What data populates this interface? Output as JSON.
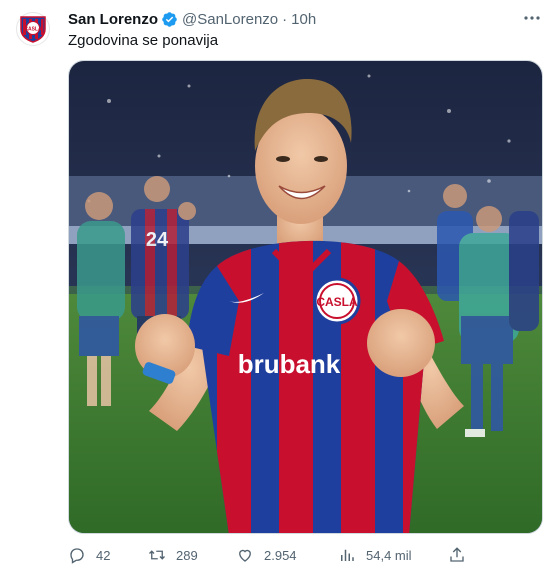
{
  "tweet": {
    "author": {
      "display_name": "San Lorenzo",
      "verified": true,
      "handle": "@SanLorenzo",
      "separator": "·",
      "timestamp": "10h",
      "avatar_icon": "san-lorenzo-crest-icon"
    },
    "text": "Zgodovina se ponavija",
    "media": {
      "shirt_sponsor": "brubank",
      "shirt_crest": "CASLA",
      "shirt_number": "24"
    },
    "actions": {
      "replies": "42",
      "retweets": "289",
      "likes": "2.954",
      "views": "54,4 mil"
    }
  },
  "colors": {
    "text_primary": "#0f1419",
    "text_secondary": "#536471",
    "verified_blue": "#1d9bf0",
    "kit_blue": "#1f3f9e",
    "kit_red": "#c8102e"
  }
}
